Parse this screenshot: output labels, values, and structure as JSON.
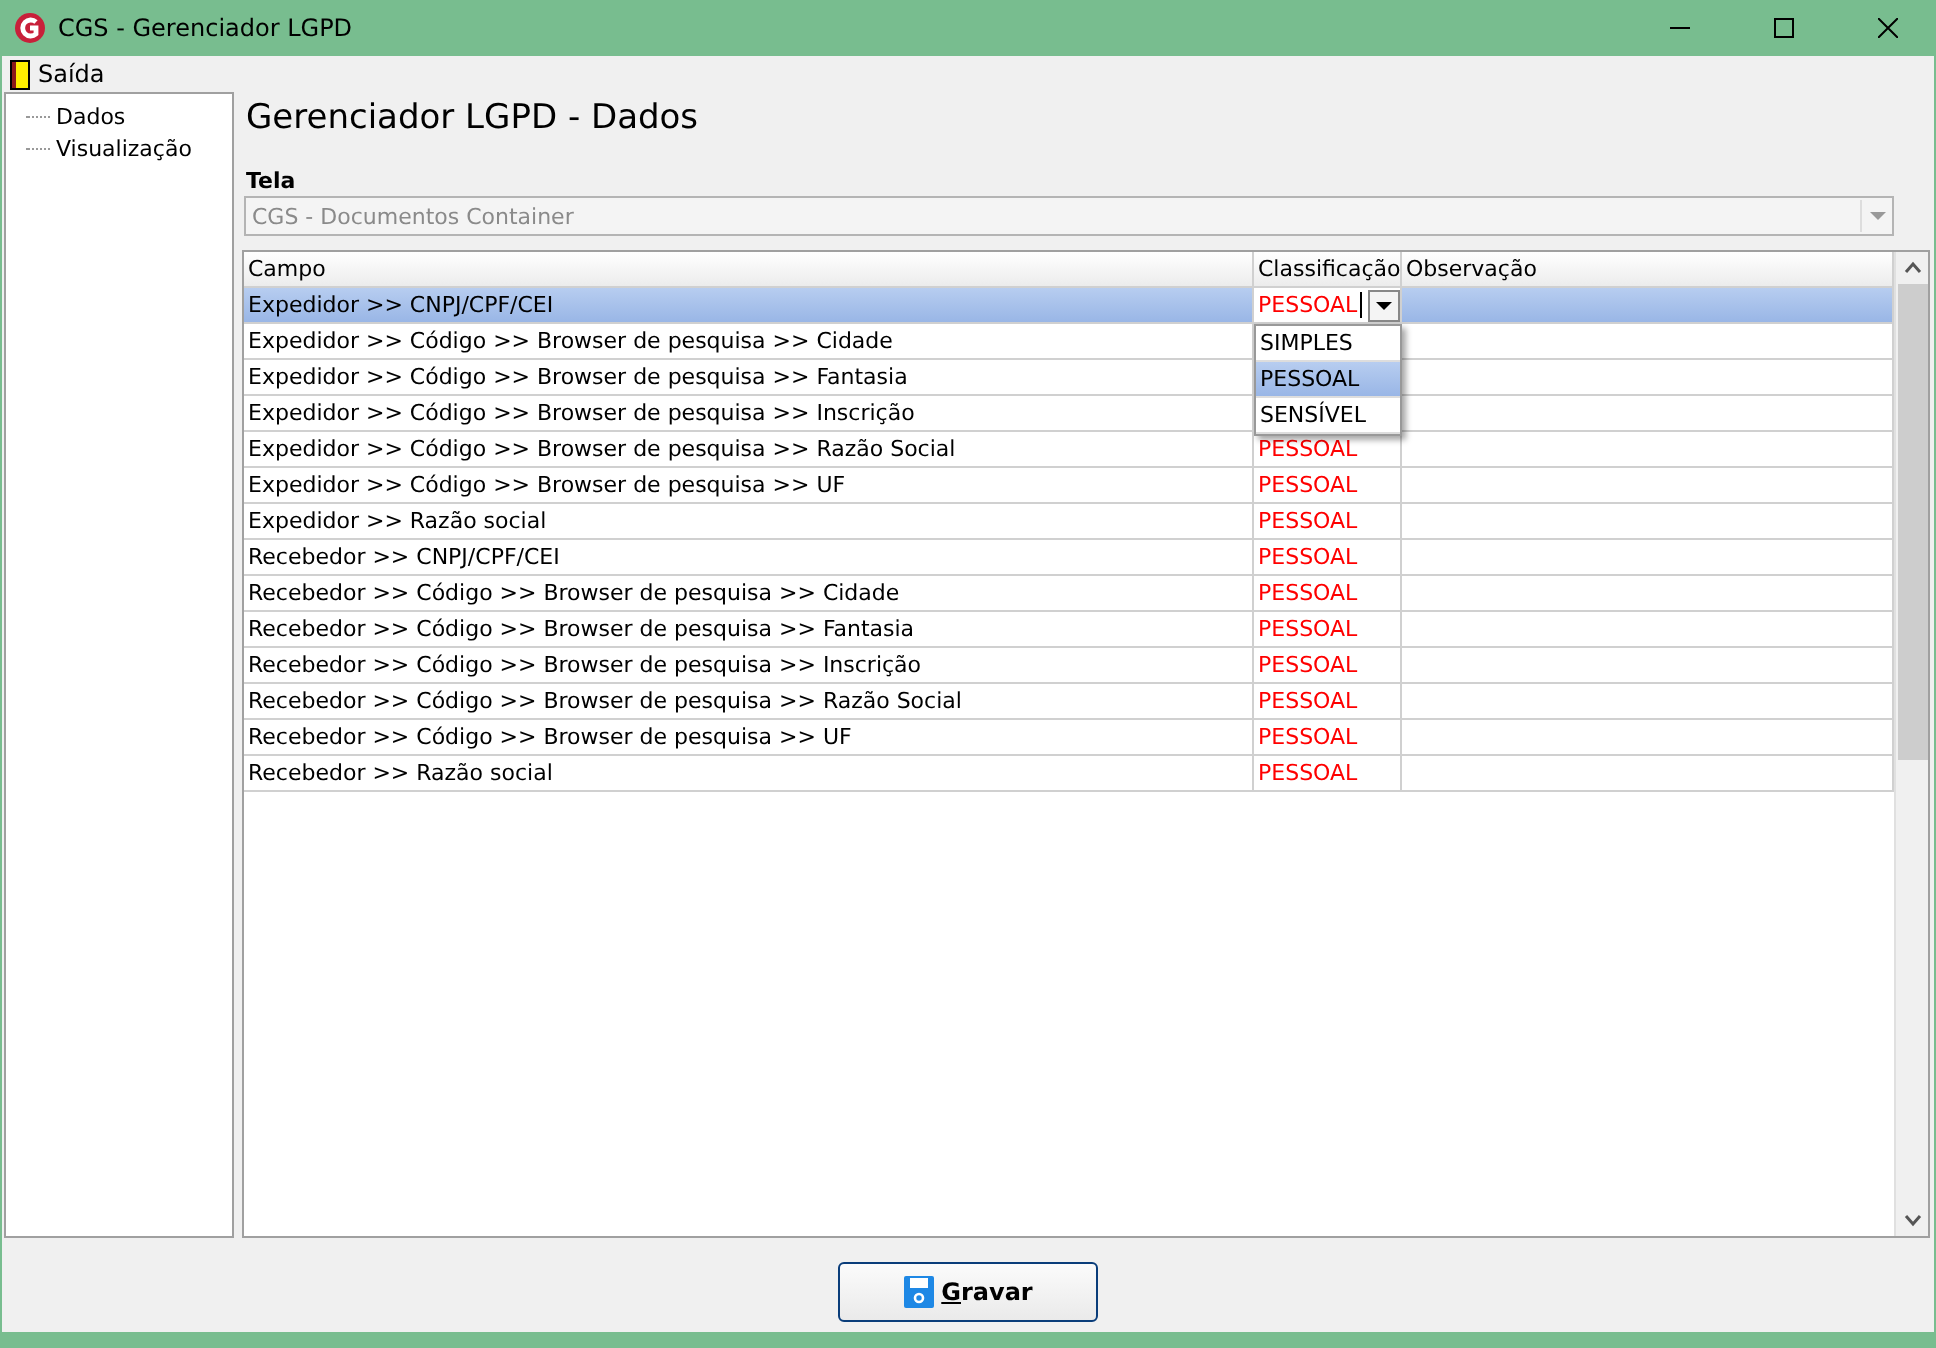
{
  "window": {
    "title": "CGS - Gerenciador LGPD"
  },
  "menu": [
    {
      "label": "Saída"
    }
  ],
  "tree": [
    {
      "label": "Dados",
      "selected": false
    },
    {
      "label": "Visualização",
      "selected": false
    }
  ],
  "heading": "Gerenciador LGPD - Dados",
  "screen_field": {
    "label": "Tela",
    "value": "CGS - Documentos Container",
    "disabled": true
  },
  "table": {
    "columns": [
      "Campo",
      "Classificação",
      "Observação"
    ],
    "rows": [
      {
        "campo": "Expedidor >> CNPJ/CPF/CEI",
        "classificacao": "PESSOAL",
        "selected": true,
        "editing": true
      },
      {
        "campo": "Expedidor >> Código >> Browser de pesquisa >> Cidade",
        "selected": false
      },
      {
        "campo": "Expedidor >> Código >> Browser de pesquisa >> Fantasia",
        "selected": false
      },
      {
        "campo": "Expedidor >> Código >> Browser de pesquisa >> Inscrição",
        "selected": false
      },
      {
        "campo": "Expedidor >> Código >> Browser de pesquisa >> Razão Social",
        "classificacao": "PESSOAL",
        "selected": false
      },
      {
        "campo": "Expedidor >> Código >> Browser de pesquisa >> UF",
        "classificacao": "PESSOAL",
        "selected": false
      },
      {
        "campo": "Expedidor >> Razão social",
        "classificacao": "PESSOAL",
        "selected": false
      },
      {
        "campo": "Recebedor >> CNPJ/CPF/CEI",
        "classificacao": "PESSOAL",
        "selected": false
      },
      {
        "campo": "Recebedor >> Código >> Browser de pesquisa >> Cidade",
        "classificacao": "PESSOAL",
        "selected": false
      },
      {
        "campo": "Recebedor >> Código >> Browser de pesquisa >> Fantasia",
        "classificacao": "PESSOAL",
        "selected": false
      },
      {
        "campo": "Recebedor >> Código >> Browser de pesquisa >> Inscrição",
        "classificacao": "PESSOAL",
        "selected": false
      },
      {
        "campo": "Recebedor >> Código >> Browser de pesquisa >> Razão Social",
        "classificacao": "PESSOAL",
        "selected": false
      },
      {
        "campo": "Recebedor >> Código >> Browser de pesquisa >> UF",
        "classificacao": "PESSOAL",
        "selected": false
      },
      {
        "campo": "Recebedor >> Razão social",
        "classificacao": "PESSOAL",
        "selected": false
      }
    ],
    "dropdown_options": [
      {
        "label": "SIMPLES",
        "selected": false
      },
      {
        "label": "PESSOAL",
        "selected": true
      },
      {
        "label": "SENSÍVEL",
        "selected": false
      }
    ]
  },
  "save_button": {
    "label": "Gravar"
  }
}
